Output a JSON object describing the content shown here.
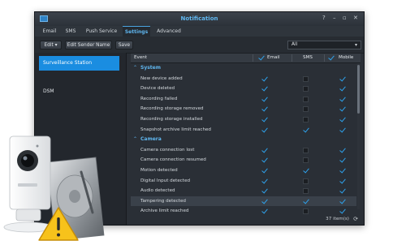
{
  "window": {
    "title": "Notification"
  },
  "tabs": [
    {
      "label": "Email"
    },
    {
      "label": "SMS"
    },
    {
      "label": "Push Service"
    },
    {
      "label": "Settings"
    },
    {
      "label": "Advanced"
    }
  ],
  "toolbar": {
    "edit_label": "Edit",
    "edit_sender_label": "Edit Sender Name",
    "save_label": "Save",
    "filter_value": "All"
  },
  "sidebar": {
    "items": [
      {
        "label": "Surveillance Station"
      },
      {
        "label": "DSM"
      }
    ]
  },
  "grid": {
    "columns": {
      "event": "Event",
      "email": "Email",
      "sms": "SMS",
      "mobile": "Mobile"
    },
    "groups": [
      {
        "label": "System",
        "rows": [
          {
            "event": "New device added",
            "email": true,
            "sms": false,
            "mobile": true
          },
          {
            "event": "Device deleted",
            "email": true,
            "sms": false,
            "mobile": true
          },
          {
            "event": "Recording failed",
            "email": true,
            "sms": false,
            "mobile": true
          },
          {
            "event": "Recording storage removed",
            "email": true,
            "sms": false,
            "mobile": true
          },
          {
            "event": "Recording storage installed",
            "email": true,
            "sms": false,
            "mobile": true
          },
          {
            "event": "Snapshot archive limit reached",
            "email": true,
            "sms": true,
            "mobile": true
          }
        ]
      },
      {
        "label": "Camera",
        "rows": [
          {
            "event": "Camera connection lost",
            "email": true,
            "sms": false,
            "mobile": true
          },
          {
            "event": "Camera connection resumed",
            "email": true,
            "sms": false,
            "mobile": true
          },
          {
            "event": "Motion detected",
            "email": true,
            "sms": true,
            "mobile": true
          },
          {
            "event": "Digital Input detected",
            "email": true,
            "sms": false,
            "mobile": true
          },
          {
            "event": "Audio detected",
            "email": true,
            "sms": false,
            "mobile": true
          },
          {
            "event": "Tampering detected",
            "email": true,
            "sms": true,
            "mobile": true
          },
          {
            "event": "Archive limit reached",
            "email": true,
            "sms": false,
            "mobile": true
          }
        ]
      }
    ],
    "item_count": "37 item(s)"
  },
  "icons": {
    "app": "app-icon",
    "help": "help-icon",
    "minimize": "minimize-icon",
    "maximize": "maximize-icon",
    "close": "close-icon",
    "refresh": "refresh-icon",
    "warning": "warning-icon"
  },
  "colors": {
    "accent": "#1a8de1",
    "check": "#2ea2ec",
    "window_bg": "#2a2f36",
    "warning": "#f7c21b"
  }
}
